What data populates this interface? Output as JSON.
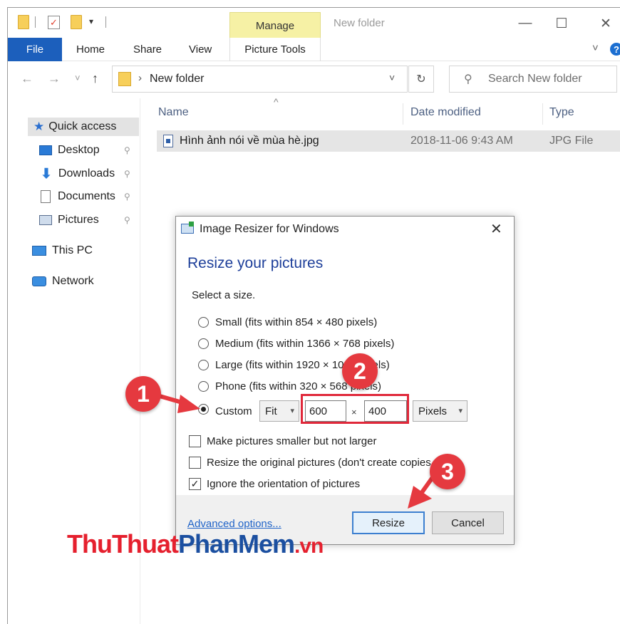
{
  "titlebar": {
    "manage_label": "Manage",
    "window_title": "New folder",
    "minimize": "—",
    "maximize": "☐",
    "close": "✕"
  },
  "ribbon": {
    "tabs": [
      "File",
      "Home",
      "Share",
      "View"
    ],
    "picture_tools": "Picture Tools",
    "collapse": "˅",
    "help": "?"
  },
  "address": {
    "back": "←",
    "forward": "→",
    "recent": "˅",
    "up": "↑",
    "separator": "›",
    "path": "New folder",
    "dropdown": "˅",
    "refresh": "↻",
    "search_placeholder": "Search New folder",
    "search_glyph": "⚲"
  },
  "nav_pane": {
    "items": [
      {
        "label": "Quick access",
        "icon": "star-icon",
        "pinned": false
      },
      {
        "label": "Desktop",
        "icon": "desktop-icon",
        "pinned": true
      },
      {
        "label": "Downloads",
        "icon": "download-icon",
        "pinned": true
      },
      {
        "label": "Documents",
        "icon": "document-icon",
        "pinned": true
      },
      {
        "label": "Pictures",
        "icon": "picture-icon",
        "pinned": true
      },
      {
        "label": "This PC",
        "icon": "computer-icon",
        "pinned": false
      },
      {
        "label": "Network",
        "icon": "network-icon",
        "pinned": false
      }
    ],
    "pin_glyph": "📌"
  },
  "file_list": {
    "columns": [
      "Name",
      "Date modified",
      "Type"
    ],
    "sort_glyph": "^",
    "rows": [
      {
        "name": "Hình ảnh nói về mùa hè.jpg",
        "date": "2018-11-06 9:43 AM",
        "type": "JPG File"
      }
    ]
  },
  "dialog": {
    "title": "Image Resizer for Windows",
    "close": "✕",
    "heading": "Resize your pictures",
    "subheading": "Select a size.",
    "sizes": [
      {
        "label": "Small (fits within 854 × 480 pixels)",
        "selected": false
      },
      {
        "label": "Medium (fits within 1366 × 768 pixels)",
        "selected": false
      },
      {
        "label": "Large (fits within 1920 × 1080 pixels)",
        "selected": false
      },
      {
        "label": "Phone (fits within 320 × 568 pixels)",
        "selected": false
      }
    ],
    "custom": {
      "label": "Custom",
      "selected": true,
      "mode": "Fit",
      "width": "600",
      "times": "×",
      "height": "400",
      "unit": "Pixels"
    },
    "options": [
      {
        "label": "Make pictures smaller but not larger",
        "checked": false
      },
      {
        "label": "Resize the original pictures (don't create copies)",
        "checked": false
      },
      {
        "label": "Ignore the orientation of pictures",
        "checked": true
      }
    ],
    "advanced_link": "Advanced options...",
    "resize_button": "Resize",
    "cancel_button": "Cancel"
  },
  "annotations": {
    "step1": "1",
    "step2": "2",
    "step3": "3",
    "color": "#e5393f"
  },
  "watermark": {
    "part1": "ThuThuat",
    "part2": "PhanMem",
    "part3": ".vn"
  }
}
